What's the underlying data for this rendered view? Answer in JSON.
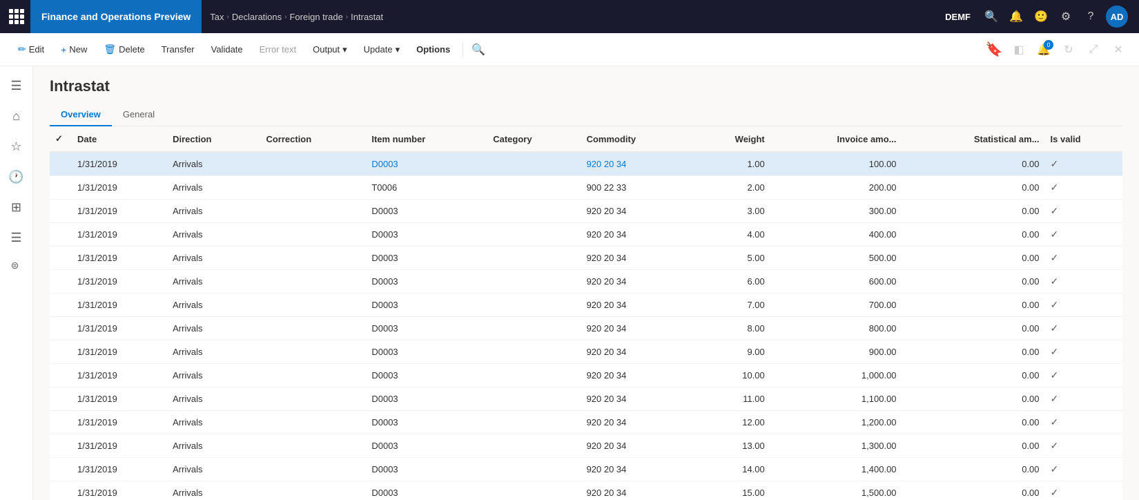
{
  "topNav": {
    "appTitle": "Finance and Operations Preview",
    "breadcrumbs": [
      "Tax",
      "Declarations",
      "Foreign trade",
      "Intrastat"
    ],
    "envBadge": "DEMF",
    "avatarInitials": "AD",
    "notifCount": "0"
  },
  "toolbar": {
    "editLabel": "Edit",
    "newLabel": "New",
    "deleteLabel": "Delete",
    "transferLabel": "Transfer",
    "validateLabel": "Validate",
    "errorTextLabel": "Error text",
    "outputLabel": "Output",
    "updateLabel": "Update",
    "optionsLabel": "Options"
  },
  "page": {
    "title": "Intrastat",
    "tabs": [
      "Overview",
      "General"
    ]
  },
  "table": {
    "columns": [
      "",
      "Date",
      "Direction",
      "Correction",
      "Item number",
      "Category",
      "Commodity",
      "Weight",
      "Invoice amo...",
      "Statistical am...",
      "Is valid"
    ],
    "rows": [
      {
        "date": "1/31/2019",
        "direction": "Arrivals",
        "correction": "",
        "itemNumber": "D0003",
        "category": "",
        "commodity": "920 20 34",
        "weight": "1.00",
        "invoiceAmt": "100.00",
        "statisticalAmt": "0.00",
        "isValid": true,
        "selected": true
      },
      {
        "date": "1/31/2019",
        "direction": "Arrivals",
        "correction": "",
        "itemNumber": "T0006",
        "category": "",
        "commodity": "900 22 33",
        "weight": "2.00",
        "invoiceAmt": "200.00",
        "statisticalAmt": "0.00",
        "isValid": true,
        "selected": false
      },
      {
        "date": "1/31/2019",
        "direction": "Arrivals",
        "correction": "",
        "itemNumber": "D0003",
        "category": "",
        "commodity": "920 20 34",
        "weight": "3.00",
        "invoiceAmt": "300.00",
        "statisticalAmt": "0.00",
        "isValid": true,
        "selected": false
      },
      {
        "date": "1/31/2019",
        "direction": "Arrivals",
        "correction": "",
        "itemNumber": "D0003",
        "category": "",
        "commodity": "920 20 34",
        "weight": "4.00",
        "invoiceAmt": "400.00",
        "statisticalAmt": "0.00",
        "isValid": true,
        "selected": false
      },
      {
        "date": "1/31/2019",
        "direction": "Arrivals",
        "correction": "",
        "itemNumber": "D0003",
        "category": "",
        "commodity": "920 20 34",
        "weight": "5.00",
        "invoiceAmt": "500.00",
        "statisticalAmt": "0.00",
        "isValid": true,
        "selected": false
      },
      {
        "date": "1/31/2019",
        "direction": "Arrivals",
        "correction": "",
        "itemNumber": "D0003",
        "category": "",
        "commodity": "920 20 34",
        "weight": "6.00",
        "invoiceAmt": "600.00",
        "statisticalAmt": "0.00",
        "isValid": true,
        "selected": false
      },
      {
        "date": "1/31/2019",
        "direction": "Arrivals",
        "correction": "",
        "itemNumber": "D0003",
        "category": "",
        "commodity": "920 20 34",
        "weight": "7.00",
        "invoiceAmt": "700.00",
        "statisticalAmt": "0.00",
        "isValid": true,
        "selected": false
      },
      {
        "date": "1/31/2019",
        "direction": "Arrivals",
        "correction": "",
        "itemNumber": "D0003",
        "category": "",
        "commodity": "920 20 34",
        "weight": "8.00",
        "invoiceAmt": "800.00",
        "statisticalAmt": "0.00",
        "isValid": true,
        "selected": false
      },
      {
        "date": "1/31/2019",
        "direction": "Arrivals",
        "correction": "",
        "itemNumber": "D0003",
        "category": "",
        "commodity": "920 20 34",
        "weight": "9.00",
        "invoiceAmt": "900.00",
        "statisticalAmt": "0.00",
        "isValid": true,
        "selected": false
      },
      {
        "date": "1/31/2019",
        "direction": "Arrivals",
        "correction": "",
        "itemNumber": "D0003",
        "category": "",
        "commodity": "920 20 34",
        "weight": "10.00",
        "invoiceAmt": "1,000.00",
        "statisticalAmt": "0.00",
        "isValid": true,
        "selected": false
      },
      {
        "date": "1/31/2019",
        "direction": "Arrivals",
        "correction": "",
        "itemNumber": "D0003",
        "category": "",
        "commodity": "920 20 34",
        "weight": "11.00",
        "invoiceAmt": "1,100.00",
        "statisticalAmt": "0.00",
        "isValid": true,
        "selected": false
      },
      {
        "date": "1/31/2019",
        "direction": "Arrivals",
        "correction": "",
        "itemNumber": "D0003",
        "category": "",
        "commodity": "920 20 34",
        "weight": "12.00",
        "invoiceAmt": "1,200.00",
        "statisticalAmt": "0.00",
        "isValid": true,
        "selected": false
      },
      {
        "date": "1/31/2019",
        "direction": "Arrivals",
        "correction": "",
        "itemNumber": "D0003",
        "category": "",
        "commodity": "920 20 34",
        "weight": "13.00",
        "invoiceAmt": "1,300.00",
        "statisticalAmt": "0.00",
        "isValid": true,
        "selected": false
      },
      {
        "date": "1/31/2019",
        "direction": "Arrivals",
        "correction": "",
        "itemNumber": "D0003",
        "category": "",
        "commodity": "920 20 34",
        "weight": "14.00",
        "invoiceAmt": "1,400.00",
        "statisticalAmt": "0.00",
        "isValid": true,
        "selected": false
      },
      {
        "date": "1/31/2019",
        "direction": "Arrivals",
        "correction": "",
        "itemNumber": "D0003",
        "category": "",
        "commodity": "920 20 34",
        "weight": "15.00",
        "invoiceAmt": "1,500.00",
        "statisticalAmt": "0.00",
        "isValid": true,
        "selected": false
      }
    ]
  }
}
